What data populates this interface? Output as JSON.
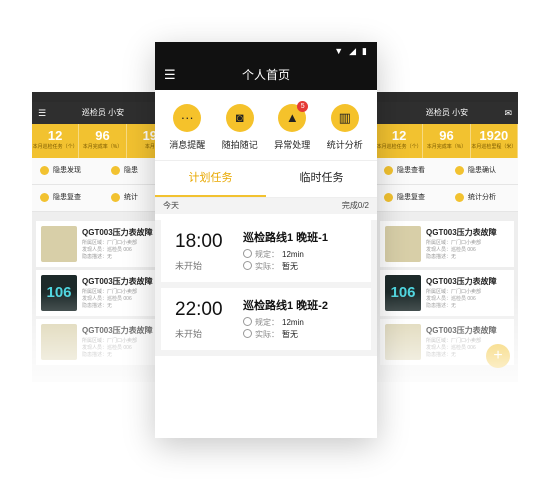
{
  "side_left": {
    "title": "巡检员 小安",
    "stats": [
      {
        "value": "12",
        "label": "本月巡检任务（个）"
      },
      {
        "value": "96",
        "label": "本月完成率（%）"
      },
      {
        "value": "19",
        "label": "本月"
      }
    ],
    "grid": [
      "隐患发现",
      "隐患",
      "隐患复查",
      "统计"
    ],
    "items": [
      {
        "title": "QGT003压力表故障",
        "lines": [
          "所属区域：厂门口小卖部",
          "发现人员：巡检员 006",
          "隐患描述：无"
        ],
        "thumb": ""
      },
      {
        "title": "QGT003压力表故障",
        "lines": [
          "所属区域：厂门口小卖部",
          "发现人员：巡检员 006",
          "隐患描述：无"
        ],
        "thumb": "106"
      },
      {
        "title": "QGT003压力表故障",
        "lines": [
          "所属区域：厂门口小卖部",
          "发现人员：巡检员 006",
          "隐患描述：无"
        ],
        "thumb": ""
      }
    ]
  },
  "side_right": {
    "title": "巡检员 小安",
    "stats": [
      {
        "value": "12",
        "label": "本月巡检任务（个）"
      },
      {
        "value": "96",
        "label": "本月完成率（%）"
      },
      {
        "value": "1920",
        "label": "本月巡检里程（米）"
      }
    ],
    "grid": [
      "隐患查看",
      "隐患确认",
      "隐患复查",
      "统计分析"
    ],
    "items": [
      {
        "title": "QGT003压力表故障",
        "lines": [
          "所属区域：厂门口小卖部",
          "发现人员：巡检员 006",
          "隐患描述：无"
        ],
        "thumb": ""
      },
      {
        "title": "QGT003压力表故障",
        "lines": [
          "所属区域：厂门口小卖部",
          "发现人员：巡检员 006",
          "隐患描述：无"
        ],
        "thumb": "106"
      },
      {
        "title": "QGT003压力表故障",
        "lines": [
          "所属区域：厂门口小卖部",
          "发现人员：巡检员 006",
          "隐患描述：无"
        ],
        "thumb": ""
      }
    ]
  },
  "main": {
    "title": "个人首页",
    "quick_actions": [
      {
        "label": "消息提醒",
        "icon": "message-icon",
        "glyph": "···",
        "badge": ""
      },
      {
        "label": "随拍随记",
        "icon": "camera-icon",
        "glyph": "◙",
        "badge": ""
      },
      {
        "label": "异常处理",
        "icon": "warning-icon",
        "glyph": "▲",
        "badge": "5"
      },
      {
        "label": "统计分析",
        "icon": "chart-icon",
        "glyph": "▥",
        "badge": ""
      }
    ],
    "tabs": {
      "plan": "计划任务",
      "temp": "临时任务"
    },
    "section": {
      "day": "今天",
      "progress": "完成0/2"
    },
    "tasks": [
      {
        "time": "18:00",
        "status": "未开始",
        "name": "巡检路线1 晚班-1",
        "rule_label": "规定：",
        "rule_value": "12min",
        "actual_label": "实际：",
        "actual_value": "暂无"
      },
      {
        "time": "22:00",
        "status": "未开始",
        "name": "巡检路线1 晚班-2",
        "rule_label": "规定：",
        "rule_value": "12min",
        "actual_label": "实际：",
        "actual_value": "暂无"
      }
    ]
  }
}
